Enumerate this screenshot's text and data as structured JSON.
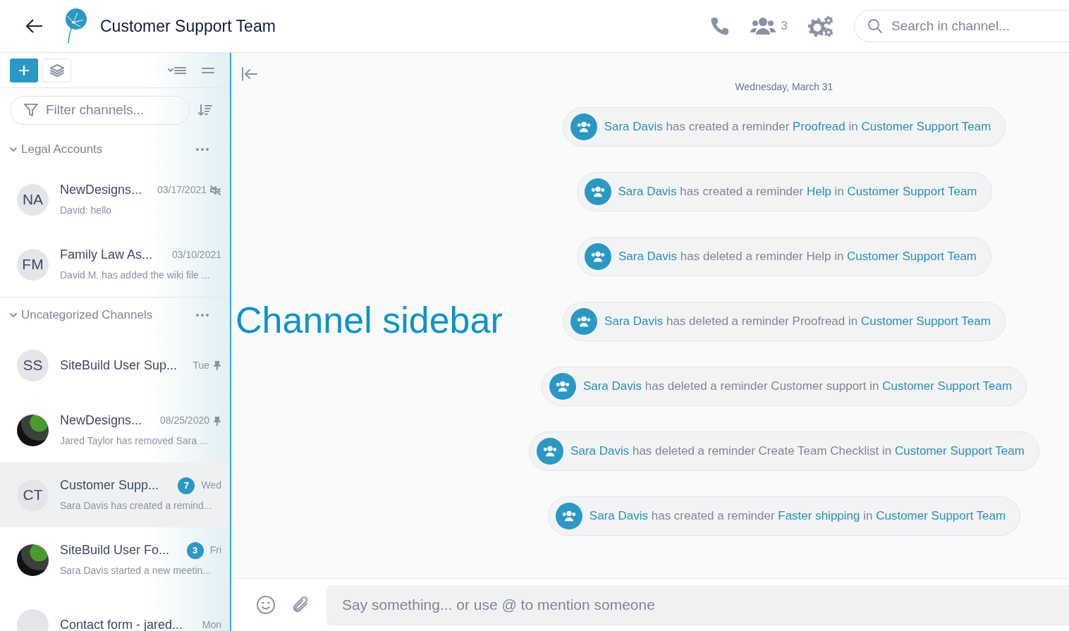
{
  "header": {
    "title": "Customer Support Team",
    "member_count": "3",
    "search": {
      "placeholder": "Search in channel..."
    }
  },
  "sidebar": {
    "filter": {
      "placeholder": "Filter channels..."
    },
    "groups": [
      {
        "title": "Legal Accounts",
        "expanded": true,
        "items": [
          {
            "kind": "initials",
            "initials": "NA",
            "name": "NewDesigns...",
            "date": "03/17/2021",
            "preview": "David: hello",
            "muted": true,
            "pinned": false,
            "selected": false
          },
          {
            "kind": "initials",
            "initials": "FM",
            "name": "Family Law As...",
            "date": "03/10/2021",
            "preview": "David M. has added the wiki file ...",
            "muted": false,
            "pinned": false,
            "selected": false
          }
        ]
      },
      {
        "title": "Uncategorized Channels",
        "expanded": true,
        "items": [
          {
            "kind": "initials",
            "initials": "SS",
            "name": "SiteBuild User Sup...",
            "date": "Tue",
            "muted": false,
            "pinned": true,
            "selected": false
          },
          {
            "kind": "photo",
            "name": "NewDesigns...",
            "date": "08/25/2020",
            "preview": "Jared Taylor has removed Sara ...",
            "muted": false,
            "pinned": true,
            "selected": false
          },
          {
            "kind": "initials",
            "initials": "CT",
            "name": "Customer Supp...",
            "date": "Wed",
            "unread": "7",
            "preview": "Sara Davis has created a remind...",
            "muted": false,
            "pinned": false,
            "selected": true
          },
          {
            "kind": "photo",
            "name": "SiteBuild User Fo...",
            "date": "Fri",
            "unread": "3",
            "preview": "Sara Davis started a new meetin...",
            "muted": false,
            "pinned": false,
            "selected": false
          },
          {
            "kind": "blank",
            "name": "Contact form - jared...",
            "date": "Mon",
            "muted": false,
            "pinned": false,
            "selected": false
          }
        ]
      }
    ]
  },
  "chat": {
    "date_divider": "Wednesday, March 31",
    "events": [
      {
        "actor": "Sara Davis",
        "action": "has created a reminder",
        "target": "Proofread",
        "target_linked": true,
        "preposition": "in",
        "channel": "Customer Support Team"
      },
      {
        "actor": "Sara Davis",
        "action": "has created a reminder",
        "target": "Help",
        "target_linked": true,
        "preposition": "in",
        "channel": "Customer Support Team"
      },
      {
        "actor": "Sara Davis",
        "action": "has deleted a reminder",
        "target": "Help",
        "target_linked": false,
        "preposition": "in",
        "channel": "Customer Support Team"
      },
      {
        "actor": "Sara Davis",
        "action": "has deleted a reminder",
        "target": "Proofread",
        "target_linked": false,
        "preposition": "in",
        "channel": "Customer Support Team"
      },
      {
        "actor": "Sara Davis",
        "action": "has deleted a reminder",
        "target": "Customer support",
        "target_linked": false,
        "preposition": "in",
        "channel": "Customer Support Team"
      },
      {
        "actor": "Sara Davis",
        "action": "has deleted a reminder",
        "target": "Create Team Checklist",
        "target_linked": false,
        "preposition": "in",
        "channel": "Customer Support Team"
      },
      {
        "actor": "Sara Davis",
        "action": "has created a reminder",
        "target": "Faster shipping",
        "target_linked": true,
        "preposition": "in",
        "channel": "Customer Support Team"
      }
    ],
    "composer": {
      "placeholder": "Say something... or use @ to mention someone"
    }
  },
  "annotation": {
    "label": "Channel sidebar"
  }
}
